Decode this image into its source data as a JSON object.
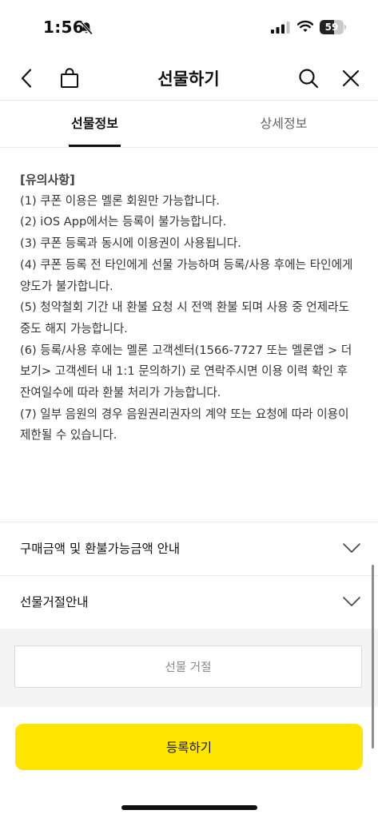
{
  "status_bar": {
    "time": "1:56",
    "battery_level": "59",
    "battery_fraction": 0.59,
    "icons": [
      "bell-slash-icon",
      "signal-icon",
      "wifi-icon",
      "battery-icon"
    ]
  },
  "nav": {
    "title": "선물하기",
    "icons": [
      "back-icon",
      "shopping-bag-icon",
      "search-icon",
      "close-icon"
    ]
  },
  "tabs": [
    {
      "label": "선물정보",
      "active": true
    },
    {
      "label": "상세정보",
      "active": false
    }
  ],
  "notice": {
    "title": "[유의사항]",
    "items": [
      "(1) 쿠폰 이용은 멜론 회원만 가능합니다.",
      "(2) iOS App에서는 등록이 불가능합니다.",
      "(3) 쿠폰 등록과 동시에 이용권이 사용됩니다.",
      "(4) 쿠폰 등록 전 타인에게 선물 가능하며 등록/사용 후에는 타인에게 양도가 불가합니다.",
      "(5) 청약철회 기간 내 환불 요청 시 전액 환불 되며 사용 중 언제라도 중도 해지 가능합니다.",
      "(6) 등록/사용 후에는 멜론 고객센터(1566-7727 또는 멜론앱 > 더보기> 고객센터 내 1:1 문의하기) 로 연락주시면 이용 이력 확인 후 잔여일수에 따라 환불 처리가 가능합니다.",
      "(7) 일부 음원의 경우 음원권리권자의 계약 또는 요청에 따라 이용이 제한될 수 있습니다."
    ]
  },
  "accordions": [
    {
      "label": "구매금액 및 환불가능금액 안내"
    },
    {
      "label": "선물거절안내"
    }
  ],
  "buttons": {
    "reject": "선물 거절",
    "register": "등록하기"
  },
  "colors": {
    "accent_yellow": "#ffe600",
    "text_primary": "#111111",
    "text_muted": "#8a8a8a",
    "divider": "#ececec",
    "panel_bg": "#f4f4f4"
  }
}
